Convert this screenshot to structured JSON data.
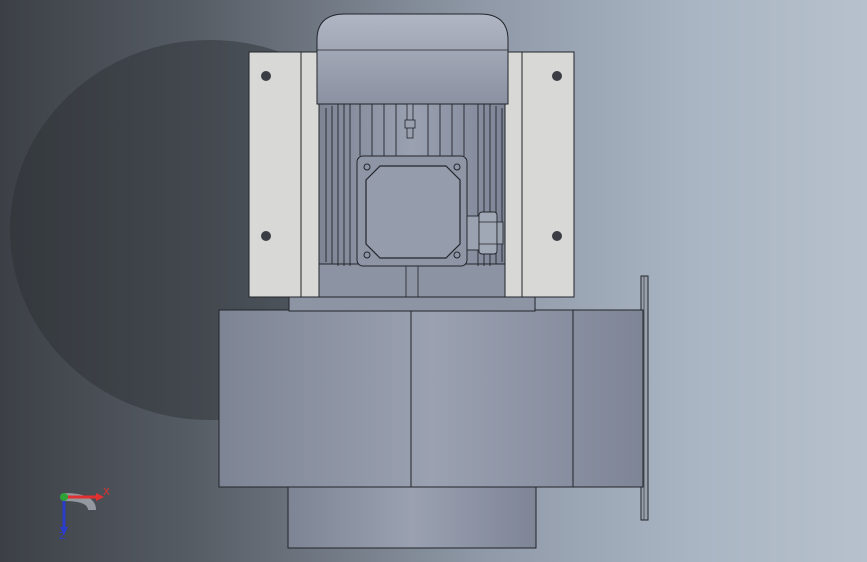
{
  "scene": {
    "model": "centrifugal-fan-with-motor",
    "view": "front"
  },
  "triad": {
    "x_label": "X",
    "z_label": "Z",
    "x_color": "#e03030",
    "z_color": "#2a3ccc",
    "y_color": "#2fa23a"
  },
  "colors": {
    "background_dark": "#3c4046",
    "background_light": "#b7c1cd",
    "metal": "#8c93a3",
    "bracket": "#d7d7d5",
    "outline": "#22252b"
  }
}
